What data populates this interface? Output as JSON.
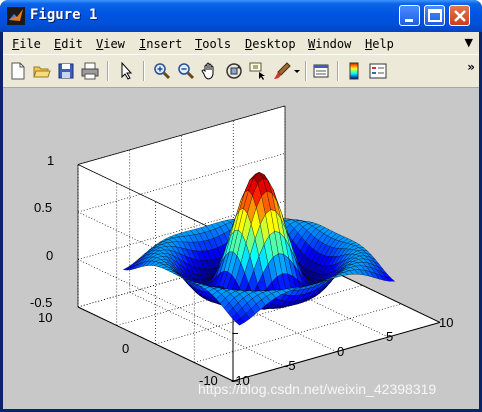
{
  "window": {
    "title": "Figure 1"
  },
  "menu": [
    {
      "key": "F",
      "rest": "ile"
    },
    {
      "key": "E",
      "rest": "dit"
    },
    {
      "key": "V",
      "rest": "iew"
    },
    {
      "key": "I",
      "rest": "nsert"
    },
    {
      "key": "T",
      "rest": "ools"
    },
    {
      "key": "D",
      "rest": "esktop"
    },
    {
      "key": "W",
      "rest": "indow"
    },
    {
      "key": "H",
      "rest": "elp"
    }
  ],
  "toolbar": {
    "tools": [
      "new-figure",
      "open-file",
      "save",
      "print",
      "edit-plot",
      "zoom-in",
      "zoom-out",
      "pan",
      "rotate-3d",
      "data-cursor",
      "brush",
      "link-plot",
      "colorbar",
      "legend"
    ],
    "overflow": "»"
  },
  "axes": {
    "z_ticks": [
      "1",
      "0.5",
      "0",
      "-0.5"
    ],
    "y_ticks": [
      "10",
      "0",
      "-10"
    ],
    "x_ticks": [
      "-10",
      "-5",
      "0",
      "5",
      "10"
    ],
    "colormap": "jet",
    "background": "#c8c8c8"
  },
  "watermark": "https://blog.csdn.net/weixin_42398319"
}
